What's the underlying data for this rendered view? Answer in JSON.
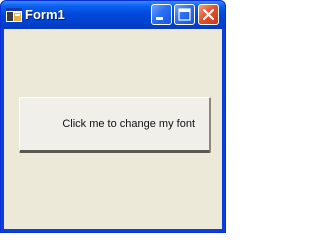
{
  "window": {
    "title": "Form1"
  },
  "titlebar": {
    "icon": "app-form-icon",
    "minimize_icon": "minimize-icon",
    "maximize_icon": "maximize-icon",
    "close_icon": "close-icon"
  },
  "form": {
    "button_label": "Click me to change my font"
  },
  "colors": {
    "titlebar": "#0047d8",
    "client": "#ece9d8",
    "close_button": "#e0542f"
  }
}
